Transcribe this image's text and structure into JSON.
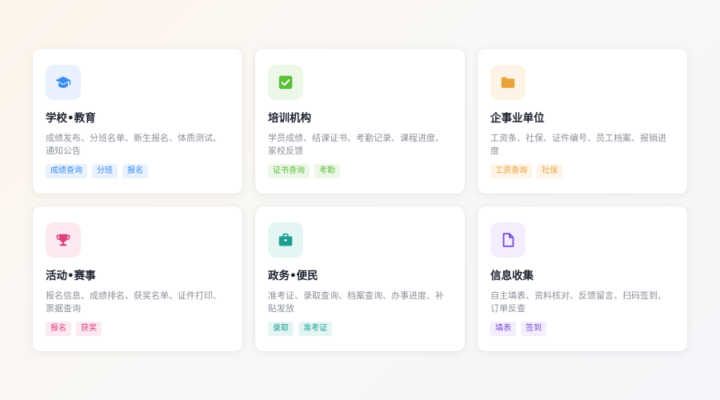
{
  "cards": [
    {
      "title": "学校•教育",
      "desc": "成绩发布、分班名单、新生报名、体质测试、通知公告",
      "icon": "graduation-cap-icon",
      "accent": "#3b8ef0",
      "icon_bg": "#e8f1fd",
      "tag_bg": "#e8f1fd",
      "tags": [
        "成绩查询",
        "分班",
        "报名"
      ]
    },
    {
      "title": "培训机构",
      "desc": "学员成绩、结课证书、考勤记录、课程进度、家校反馈",
      "icon": "checkbox-icon",
      "accent": "#5bbf3a",
      "icon_bg": "#edf7e8",
      "tag_bg": "#edf7e8",
      "tags": [
        "证书查询",
        "考勤"
      ]
    },
    {
      "title": "企事业单位",
      "desc": "工资条、社保、证件编号、员工档案、报销进度",
      "icon": "folder-icon",
      "accent": "#e9a33a",
      "icon_bg": "#fdf3e6",
      "tag_bg": "#fdf3e6",
      "tags": [
        "工资查询",
        "社保"
      ]
    },
    {
      "title": "活动•赛事",
      "desc": "报名信息、成绩排名、获奖名单、证件打印、票据查询",
      "icon": "trophy-icon",
      "accent": "#d9447f",
      "icon_bg": "#fde9f1",
      "tag_bg": "#fde9f1",
      "tags": [
        "报名",
        "获奖"
      ]
    },
    {
      "title": "政务•便民",
      "desc": "准考证、录取查询、档案查询、办事进度、补贴发放",
      "icon": "briefcase-icon",
      "accent": "#1f9e92",
      "icon_bg": "#e4f6f4",
      "tag_bg": "#e4f6f4",
      "tags": [
        "录取",
        "准考证"
      ]
    },
    {
      "title": "信息收集",
      "desc": "自主填表、资料核对、反馈留言、扫码签到、订单反查",
      "icon": "document-icon",
      "accent": "#7b4fd6",
      "icon_bg": "#f3edfc",
      "tag_bg": "#f3edfc",
      "tags": [
        "填表",
        "签到"
      ]
    }
  ]
}
